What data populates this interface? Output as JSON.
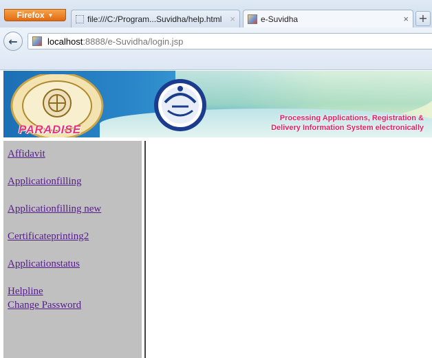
{
  "browser": {
    "menu_button_label": "Firefox",
    "tabs": [
      {
        "label": "file:///C:/Program...Suvidha/help.html",
        "close": "×",
        "icon": "blank-page-icon",
        "active": false
      },
      {
        "label": "e-Suvidha",
        "close": "×",
        "icon": "site-favicon",
        "active": true
      }
    ],
    "new_tab_label": "+",
    "back_label": "←",
    "url": {
      "host": "localhost",
      "path": ":8888/e-Suvidha/login.jsp"
    }
  },
  "banner": {
    "logo_text": "PARADISE",
    "tagline_line1": "Processing Applications, Registration &",
    "tagline_line2": "Delivery Information System electronically"
  },
  "sidebar": {
    "links": [
      {
        "label": "Affidavit"
      },
      {
        "label": "Applicationfilling"
      },
      {
        "label": "Applicationfilling new"
      },
      {
        "label": "Certificateprinting2"
      },
      {
        "label": "Applicationstatus"
      },
      {
        "label": "Helpline"
      },
      {
        "label": "Change Password"
      }
    ]
  },
  "colors": {
    "link_visited": "#551a8b",
    "sidebar_bg": "#c0c0c0",
    "tagline": "#e31f63",
    "firefox_button": "#e06b12"
  }
}
